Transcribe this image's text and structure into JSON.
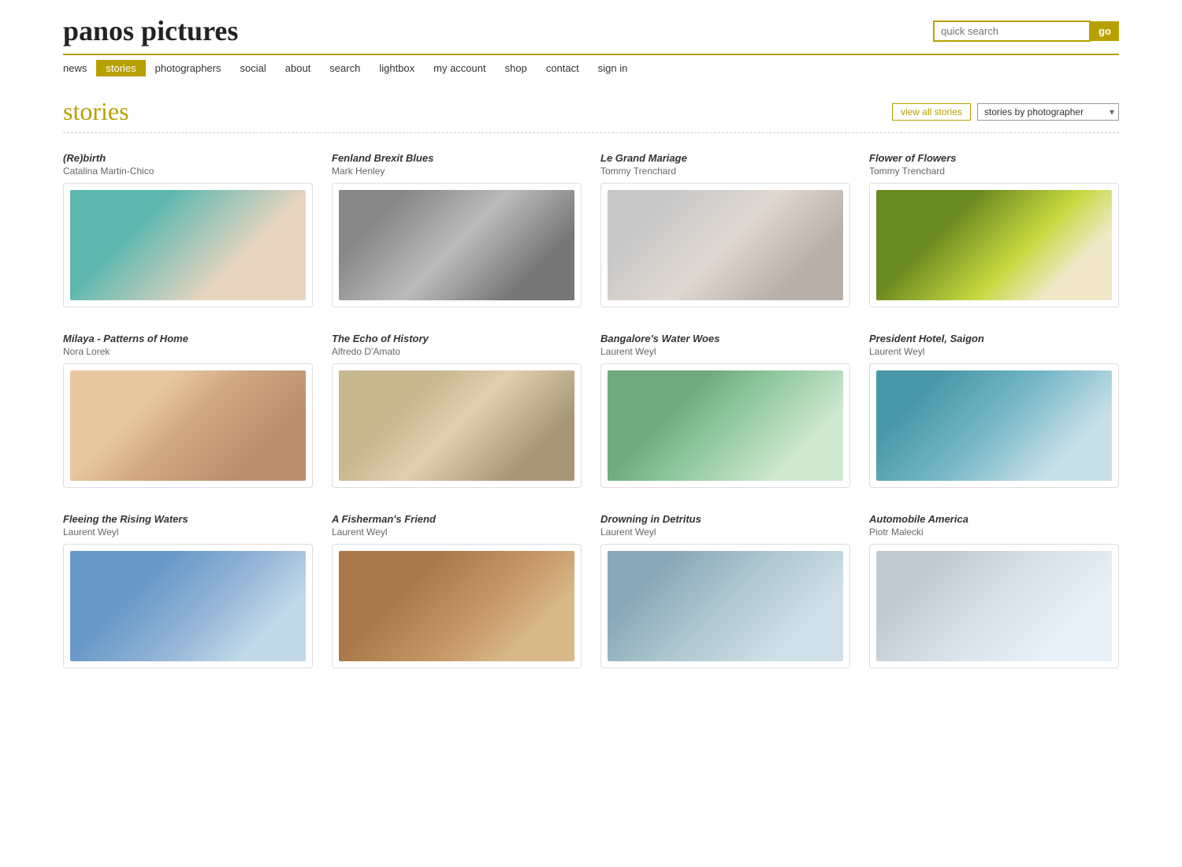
{
  "header": {
    "logo": "panos pictures",
    "search_placeholder": "quick search",
    "go_label": "go"
  },
  "nav": {
    "items": [
      {
        "label": "news",
        "active": false
      },
      {
        "label": "stories",
        "active": true
      },
      {
        "label": "photographers",
        "active": false
      },
      {
        "label": "social",
        "active": false
      },
      {
        "label": "about",
        "active": false
      },
      {
        "label": "search",
        "active": false
      },
      {
        "label": "lightbox",
        "active": false
      },
      {
        "label": "my account",
        "active": false
      },
      {
        "label": "shop",
        "active": false
      },
      {
        "label": "contact",
        "active": false
      },
      {
        "label": "sign in",
        "active": false
      }
    ]
  },
  "page": {
    "title": "stories",
    "view_all_label": "view all stories",
    "dropdown_label": "stories by photographer",
    "dropdown_options": [
      "stories by photographer",
      "Mark Henley",
      "Tommy Trenchard",
      "Laurent Weyl",
      "Nora Lorek",
      "Alfredo D'Amato",
      "Piotr Malecki",
      "Catalina Martin-Chico"
    ]
  },
  "stories": [
    {
      "title": "(Re)birth",
      "photographer": "Catalina Martin-Chico",
      "img_class": "img-rebirth"
    },
    {
      "title": "Fenland Brexit Blues",
      "photographer": "Mark Henley",
      "img_class": "img-fenland"
    },
    {
      "title": "Le Grand Mariage",
      "photographer": "Tommy Trenchard",
      "img_class": "img-mariage"
    },
    {
      "title": "Flower of Flowers",
      "photographer": "Tommy Trenchard",
      "img_class": "img-flower"
    },
    {
      "title": "Milaya - Patterns of Home",
      "photographer": "Nora Lorek",
      "img_class": "img-milaya"
    },
    {
      "title": "The Echo of History",
      "photographer": "Alfredo D'Amato",
      "img_class": "img-echo"
    },
    {
      "title": "Bangalore's Water Woes",
      "photographer": "Laurent Weyl",
      "img_class": "img-bangalore"
    },
    {
      "title": "President Hotel, Saigon",
      "photographer": "Laurent Weyl",
      "img_class": "img-president"
    },
    {
      "title": "Fleeing the Rising Waters",
      "photographer": "Laurent Weyl",
      "img_class": "img-fleeing"
    },
    {
      "title": "A Fisherman's Friend",
      "photographer": "Laurent Weyl",
      "img_class": "img-fisherman"
    },
    {
      "title": "Drowning in Detritus",
      "photographer": "Laurent Weyl",
      "img_class": "img-drowning"
    },
    {
      "title": "Automobile America",
      "photographer": "Piotr Malecki",
      "img_class": "img-automobile"
    }
  ]
}
